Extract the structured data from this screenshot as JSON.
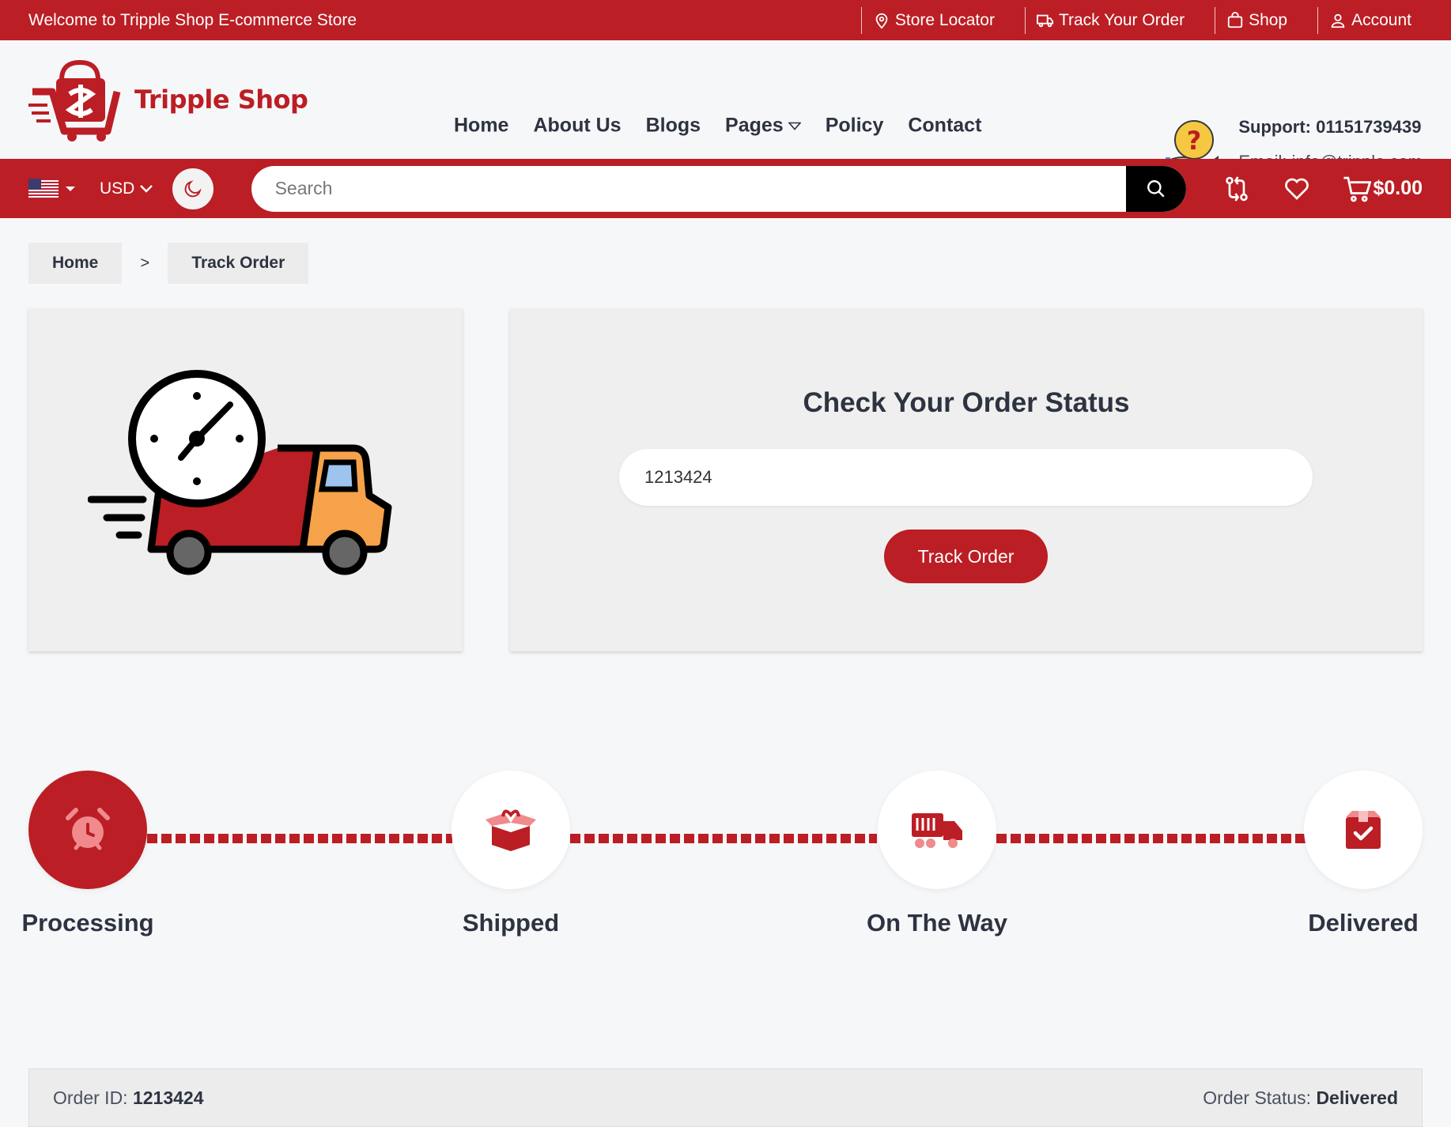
{
  "topbar": {
    "welcome": "Welcome to Tripple Shop E-commerce Store",
    "links": [
      "Store Locator",
      "Track Your Order",
      "Shop",
      "Account"
    ]
  },
  "brand": {
    "name": "Tripple Shop",
    "color": "#bb1e24"
  },
  "nav": {
    "items": [
      "Home",
      "About Us",
      "Blogs",
      "Pages",
      "Policy",
      "Contact"
    ]
  },
  "support": {
    "phone": "Support: 01151739439",
    "email": "Email: info@tripple.com"
  },
  "searchbar": {
    "currency": "USD",
    "search_placeholder": "Search",
    "cart_total": "$0.00"
  },
  "breadcrumb": {
    "home": "Home",
    "separator": ">",
    "current": "Track Order"
  },
  "track_form": {
    "title": "Check Your Order Status",
    "order_value": "1213424",
    "button": "Track Order"
  },
  "steps": [
    {
      "label": "Processing",
      "icon": "alarm-clock-icon",
      "active": true
    },
    {
      "label": "Shipped",
      "icon": "open-box-icon",
      "active": false
    },
    {
      "label": "On The Way",
      "icon": "delivery-truck-icon",
      "active": false
    },
    {
      "label": "Delivered",
      "icon": "box-check-icon",
      "active": false
    }
  ],
  "order": {
    "id_label": "Order ID:",
    "id_value": "1213424",
    "status_label": "Order Status:",
    "status_value": "Delivered"
  }
}
